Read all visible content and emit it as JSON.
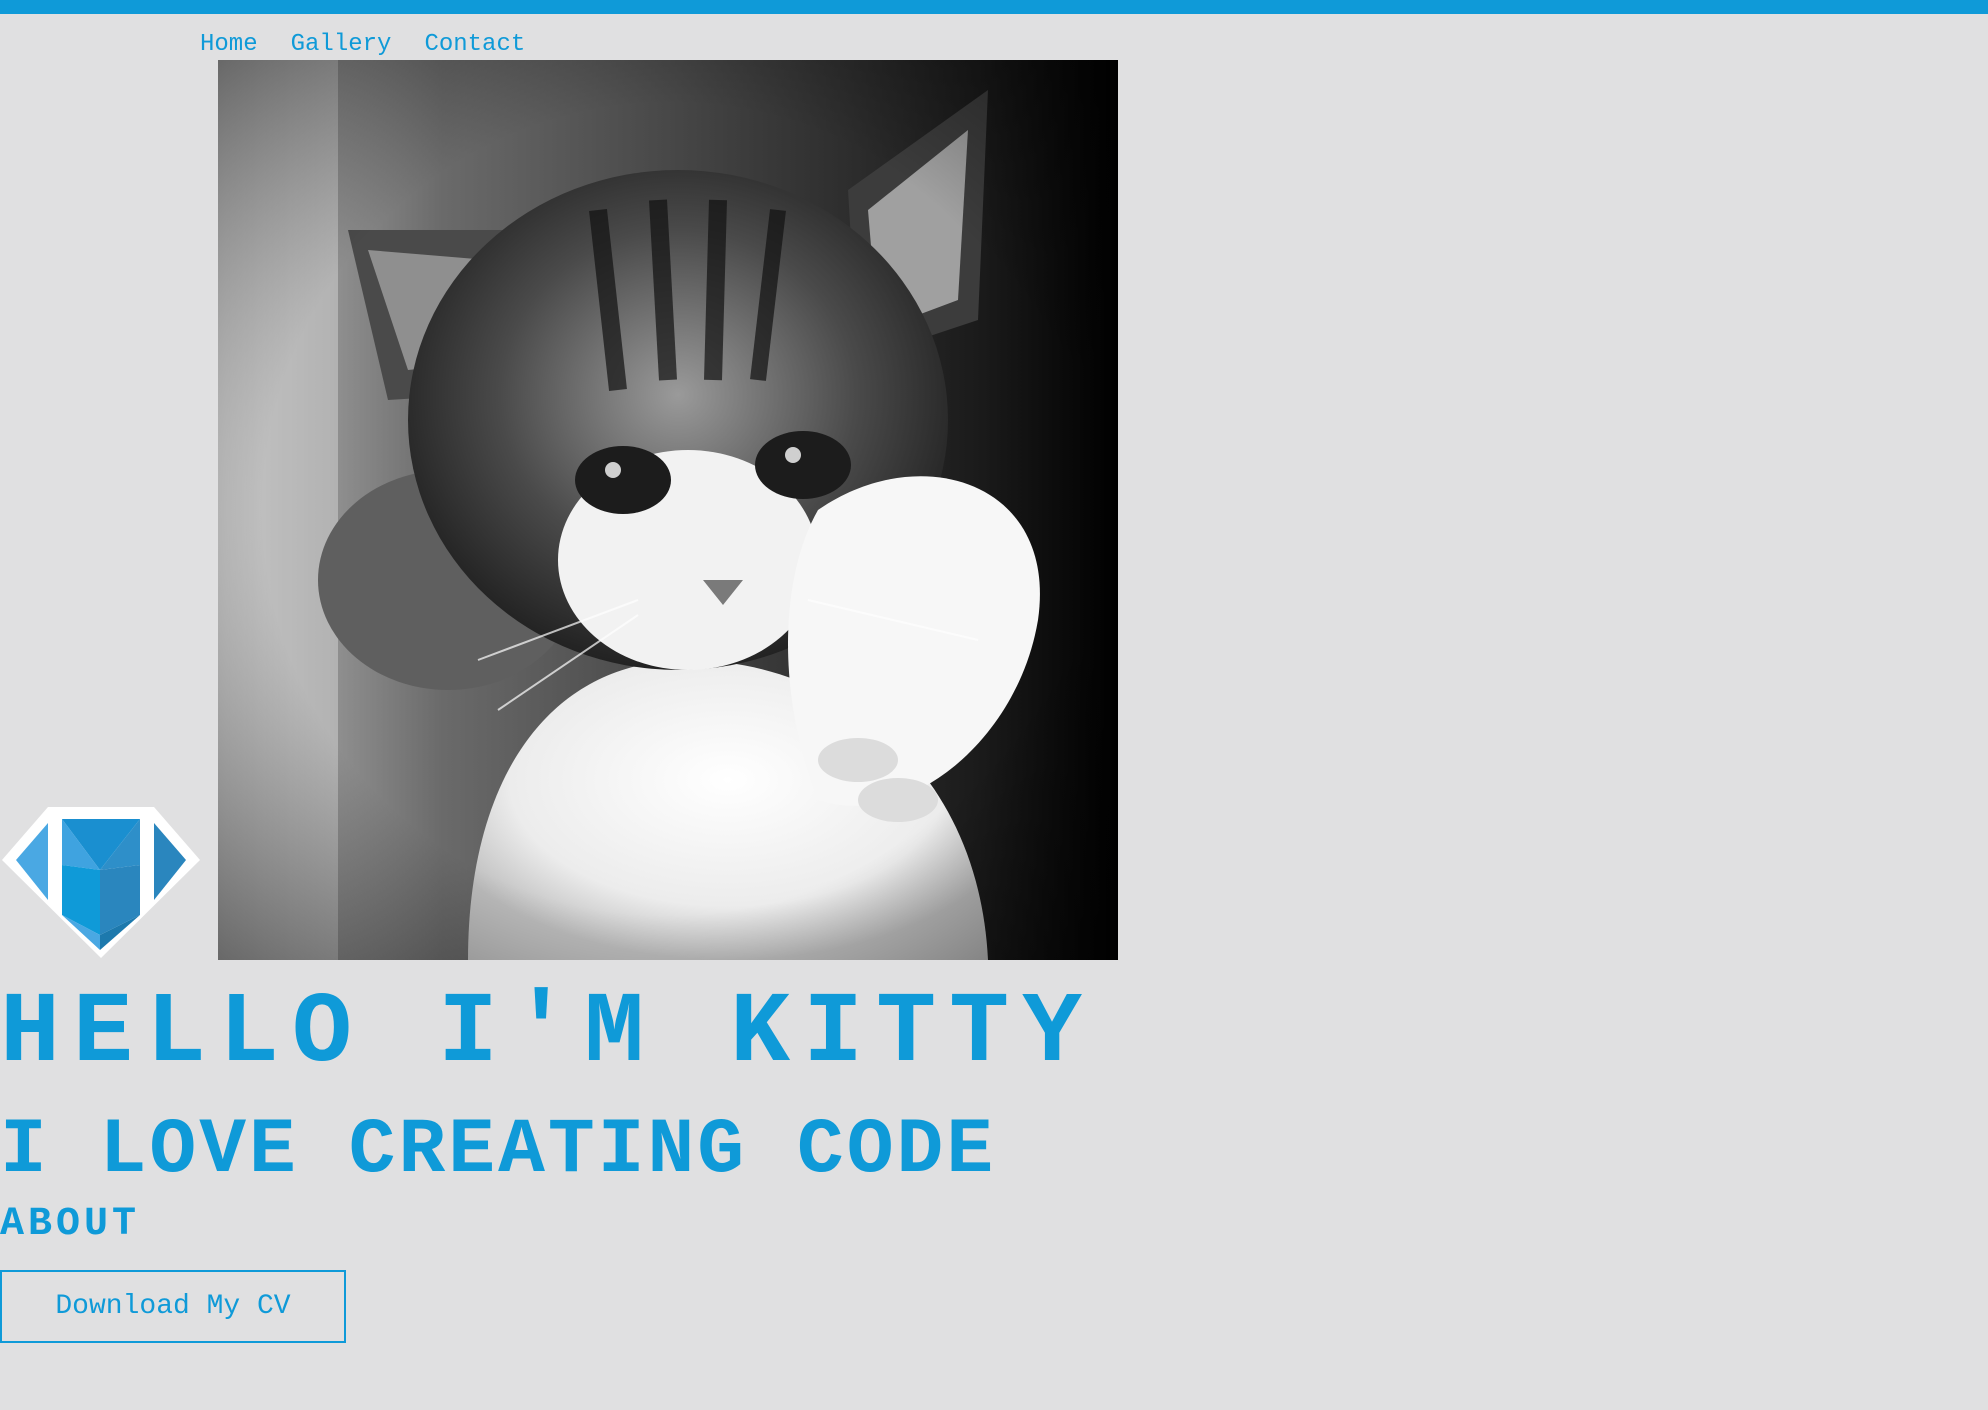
{
  "theme": {
    "accent": "#0f9ad8",
    "background": "#e0e0e1"
  },
  "nav": {
    "items": [
      {
        "label": "Home"
      },
      {
        "label": "Gallery"
      },
      {
        "label": "Contact"
      }
    ]
  },
  "hero": {
    "image_icon": "kitten-photo",
    "logo_icon": "m-diamond-logo",
    "headline": "HELLO I'M KITTY",
    "subheadline": "I LOVE CREATING CODE",
    "section_label": "ABOUT",
    "cv_button_label": "Download My CV"
  }
}
